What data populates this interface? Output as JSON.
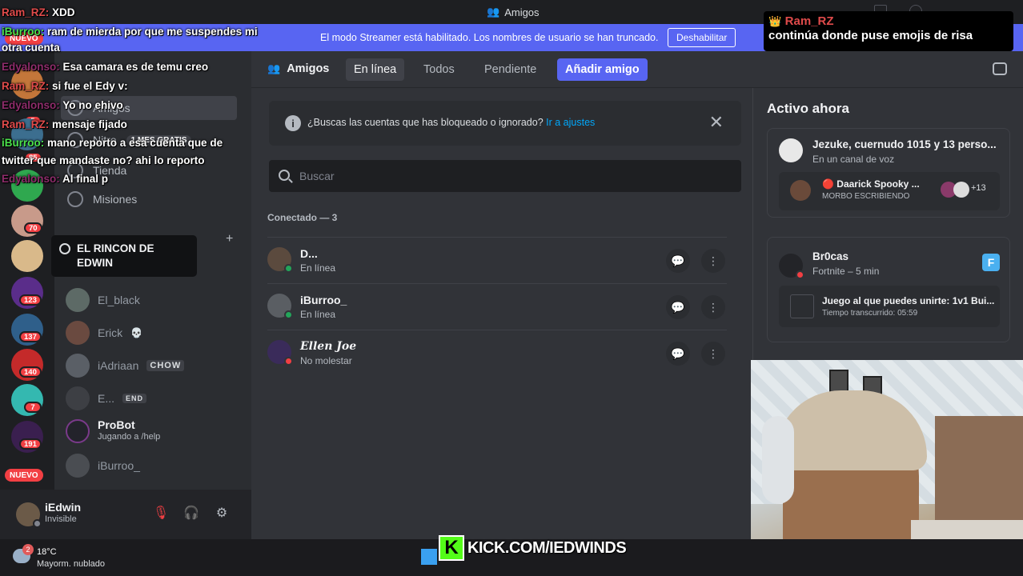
{
  "titlebar": {
    "title": "Amigos"
  },
  "banner": {
    "message": "El modo Streamer está habilitado. Los nombres de usuario se han truncado.",
    "disable_label": "Deshabilitar"
  },
  "rail": {
    "new_top": "NUEVO",
    "new_bottom": "NUEVO",
    "badges": [
      "5",
      "85",
      "70",
      "123",
      "137",
      "140",
      "7",
      "191"
    ]
  },
  "sidebar": {
    "items": [
      {
        "label": "Amigos"
      },
      {
        "label": "Nitro",
        "badge": "1 MES GRATIS"
      },
      {
        "label": "Tienda"
      },
      {
        "label": "Misiones"
      }
    ],
    "tooltip": "EL RINCON DE EDWIN",
    "dms": [
      {
        "name": "El_black"
      },
      {
        "name": "Erick"
      },
      {
        "name": "iAdriaan",
        "tag": "CHOW"
      },
      {
        "name": "E...",
        "tag": "END"
      },
      {
        "name": "ProBot",
        "sub": "Jugando a /help"
      },
      {
        "name": "iBurroo_"
      }
    ]
  },
  "user_panel": {
    "name": "iEdwin",
    "status": "Invisible"
  },
  "header": {
    "title": "Amigos",
    "tabs": [
      "En línea",
      "Todos",
      "Pendiente"
    ],
    "add_friend": "Añadir amigo"
  },
  "notice": {
    "text": "¿Buscas las cuentas que has bloqueado o ignorado?",
    "link": "Ir a ajustes"
  },
  "search": {
    "placeholder": "Buscar"
  },
  "online": {
    "label": "Conectado — 3",
    "friends": [
      {
        "name": "D...",
        "status": "En línea",
        "status_color": "#23a55a"
      },
      {
        "name": "iBurroo_",
        "status": "En línea",
        "status_color": "#23a55a"
      },
      {
        "name": "𝑬𝒍𝒍𝒆𝒏 𝑱𝒐𝒆",
        "status": "No molestar",
        "status_color": "#f23f43"
      }
    ]
  },
  "active_now": {
    "title": "Activo ahora",
    "cards": [
      {
        "name": "Jezuke, cuernudo 1015 y 13 perso...",
        "sub": "En un canal de voz",
        "inner_name": "Daarick Spooky ...",
        "inner_sub": "MORBO ESCRIBIENDO",
        "count": "+13"
      },
      {
        "name": "Br0cas",
        "sub": "Fortnite – 5 min",
        "inner_name": "Juego al que puedes unirte: 1v1 Bui...",
        "inner_sub": "Tiempo transcurrido: 05:59"
      }
    ]
  },
  "chat": [
    {
      "user": "Ram_RZ:",
      "text": "XDD"
    },
    {
      "user": "iBurroo:",
      "text": "ram de mierda por que me suspendes mi otra cuenta"
    },
    {
      "user": "Edyalonso:",
      "text": "Esa camara es de temu creo"
    },
    {
      "user": "Ram_RZ:",
      "text": "si fue el Edy v:"
    },
    {
      "user": "Edyalonso:",
      "text": "Yo no ehivo"
    },
    {
      "user": "Ram_RZ:",
      "text": "mensaje fijado"
    },
    {
      "user": "iBurroo:",
      "text": "mano reporto a esa cuenta que de twitter que mandaste no? ahi lo reporto"
    },
    {
      "user": "Edyalonso:",
      "text": "Al final p"
    }
  ],
  "pinned": {
    "user": "Ram_RZ",
    "text": "continúa donde puse emojis de risa"
  },
  "taskbar": {
    "temp": "18°C",
    "weather": "Mayorm. nublado",
    "weather_badge": "2"
  },
  "kick": {
    "url": "KICK.COM/IEDWINDS"
  },
  "colors": {
    "blurple": "#5865f2",
    "online": "#23a55a",
    "dnd": "#f23f43",
    "kick": "#53fc18"
  }
}
